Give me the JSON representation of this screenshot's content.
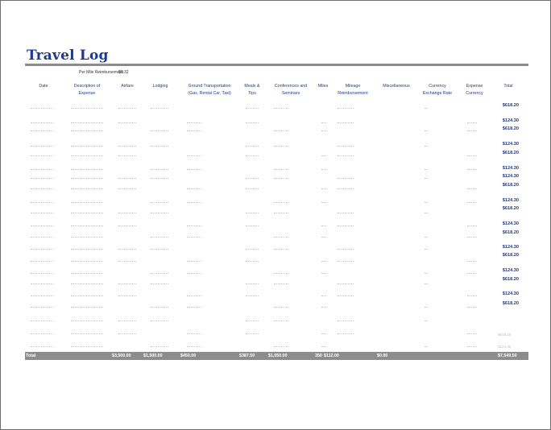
{
  "title": "Travel Log",
  "rate": {
    "label": "Per Mile Reimbursement",
    "value": "$0.32"
  },
  "headers": [
    {
      "key": "date",
      "lines": [
        "Date",
        ""
      ]
    },
    {
      "key": "description",
      "lines": [
        "Description of",
        "Expense"
      ]
    },
    {
      "key": "airfare",
      "lines": [
        "Airfare",
        ""
      ]
    },
    {
      "key": "lodging",
      "lines": [
        "Lodging",
        ""
      ]
    },
    {
      "key": "ground",
      "lines": [
        "Ground Transportation",
        "(Gas, Rental Car, Taxi)"
      ]
    },
    {
      "key": "meals",
      "lines": [
        "Meals &",
        "Tips"
      ]
    },
    {
      "key": "conferences",
      "lines": [
        "Conferences and",
        "Seminars"
      ]
    },
    {
      "key": "miles",
      "lines": [
        "Miles",
        ""
      ]
    },
    {
      "key": "mileage",
      "lines": [
        "Mileage",
        "Reimbursement"
      ]
    },
    {
      "key": "misc",
      "lines": [
        "Miscellaneous",
        ""
      ]
    },
    {
      "key": "currency_rate",
      "lines": [
        "Currency",
        "Exchange Rate"
      ]
    },
    {
      "key": "expense_currency",
      "lines": [
        "Expense",
        "Currency"
      ]
    },
    {
      "key": "total",
      "lines": [
        "Total",
        ""
      ]
    }
  ],
  "row_totals": [
    "$618.20",
    "$124.30",
    "$618.20",
    "$124.30",
    "$618.20",
    "$124.30",
    "$124.30",
    "$618.20",
    "$124.30",
    "$618.20",
    "$124.30",
    "$618.20",
    "$124.30",
    "$618.20",
    "$124.30",
    "$618.20",
    "$124.30",
    "$618.20"
  ],
  "footer_values": [
    "$618.20",
    "$124.30"
  ],
  "totals": {
    "label": "Total",
    "airfare": "$3,500.00",
    "lodging": "$1,500.00",
    "ground": "$450.00",
    "meals": "$387.50",
    "conferences": "$1,050.00",
    "miles": "350",
    "mileage": "$112.00",
    "misc": "$0.00",
    "total": "$7,549.50"
  },
  "colors": {
    "accent": "#1f3a8a",
    "bar": "#8c8c8c",
    "faint": "#c2c2c2"
  }
}
